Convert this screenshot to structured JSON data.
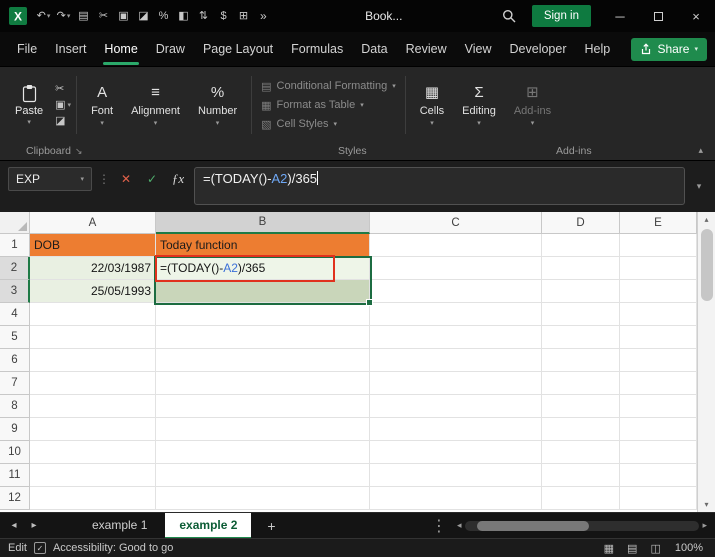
{
  "colors": {
    "accent_green": "#2ba96a",
    "signin_green": "#0e7a40",
    "share_green": "#1f8b4d",
    "header_orange": "#ED7D31",
    "cell_light_green": "#e9f0e2",
    "cell_edit_green": "#eef5e8",
    "cell_selected_green": "#c9d6ba",
    "annotation_red": "#e0311d",
    "reference_blue": "#3a6fd8"
  },
  "titlebar": {
    "doc_title": "Book...",
    "signin_label": "Sign in",
    "overflow_glyph": "»",
    "qat": [
      {
        "name": "undo-icon",
        "glyph": "↶",
        "dropdown": true
      },
      {
        "name": "redo-icon",
        "glyph": "↷",
        "dropdown": true
      },
      {
        "name": "printer-icon",
        "glyph": "▤"
      },
      {
        "name": "cut-icon",
        "glyph": "✂"
      },
      {
        "name": "copy-icon",
        "glyph": "▣"
      },
      {
        "name": "format-painter-icon",
        "glyph": "◪"
      },
      {
        "name": "percent-style-icon",
        "glyph": "%"
      },
      {
        "name": "fill-color-icon",
        "glyph": "◧"
      },
      {
        "name": "sort-filter-icon",
        "glyph": "⇅"
      },
      {
        "name": "accounting-format-icon",
        "glyph": "$"
      },
      {
        "name": "borders-icon",
        "glyph": "⊞"
      }
    ],
    "window_glyphs": {
      "minimize": "─",
      "close": "×"
    }
  },
  "menubar": {
    "tabs": [
      "File",
      "Insert",
      "Home",
      "Draw",
      "Page Layout",
      "Formulas",
      "Data",
      "Review",
      "View",
      "Developer",
      "Help"
    ],
    "active_tab": "Home",
    "share_label": "Share"
  },
  "ribbon": {
    "paste_label": "Paste",
    "mini_icons": [
      {
        "name": "cut-icon",
        "glyph": "✂"
      },
      {
        "name": "copy-icon",
        "glyph": "▣",
        "dropdown": true
      },
      {
        "name": "format-painter-icon",
        "glyph": "◪"
      }
    ],
    "collapsed_groups": [
      {
        "label": "Font",
        "icon": "A",
        "name": "font"
      },
      {
        "label": "Alignment",
        "icon": "≡",
        "name": "alignment"
      },
      {
        "label": "Number",
        "icon": "%",
        "name": "number"
      }
    ],
    "styles_items": [
      {
        "label": "Conditional Formatting",
        "icon": "▤"
      },
      {
        "label": "Format as Table",
        "icon": "▦"
      },
      {
        "label": "Cell Styles",
        "icon": "▧"
      }
    ],
    "right_groups": [
      {
        "label": "Cells",
        "icon": "▦",
        "name": "cells",
        "disabled": false
      },
      {
        "label": "Editing",
        "icon": "Σ",
        "name": "editing",
        "disabled": false
      },
      {
        "label": "Add-ins",
        "icon": "⊞",
        "name": "add-ins-top",
        "disabled": true
      }
    ],
    "group_labels": {
      "clipboard": "Clipboard",
      "styles": "Styles",
      "addins": "Add-ins"
    },
    "launcher_glyph": "↘",
    "collapse_glyph": "▴"
  },
  "formula_bar": {
    "name_box_value": "EXP",
    "cancel_glyph": "✕",
    "enter_glyph": "✓",
    "fx_glyph": "ƒx",
    "formula_prefix": "=(TODAY()-",
    "formula_ref": "A2",
    "formula_suffix": ")/365"
  },
  "grid": {
    "columns": [
      "A",
      "B",
      "C",
      "D",
      "E"
    ],
    "active_column": "B",
    "active_rows": [
      2,
      3
    ],
    "row_count": 12,
    "cells": {
      "A1": {
        "text": "DOB",
        "fill": "orange",
        "align": "left"
      },
      "B1": {
        "text": "Today function",
        "fill": "orange",
        "align": "left"
      },
      "A2": {
        "text": "22/03/1987",
        "fill": "light",
        "align": "right"
      },
      "B2": {
        "prefix": "=(TODAY()-",
        "cellref": "A2",
        "suffix": ")/365",
        "fill": "edit",
        "align": "left"
      },
      "A3": {
        "text": "25/05/1993",
        "fill": "light",
        "align": "right"
      },
      "B3": {
        "fill": "mid"
      }
    }
  },
  "sheet_tabs": {
    "tabs": [
      "example 1",
      "example 2"
    ],
    "active": "example 2",
    "add_glyph": "+"
  },
  "status_bar": {
    "mode": "Edit",
    "accessibility": "Accessibility: Good to go",
    "zoom": "100%"
  }
}
